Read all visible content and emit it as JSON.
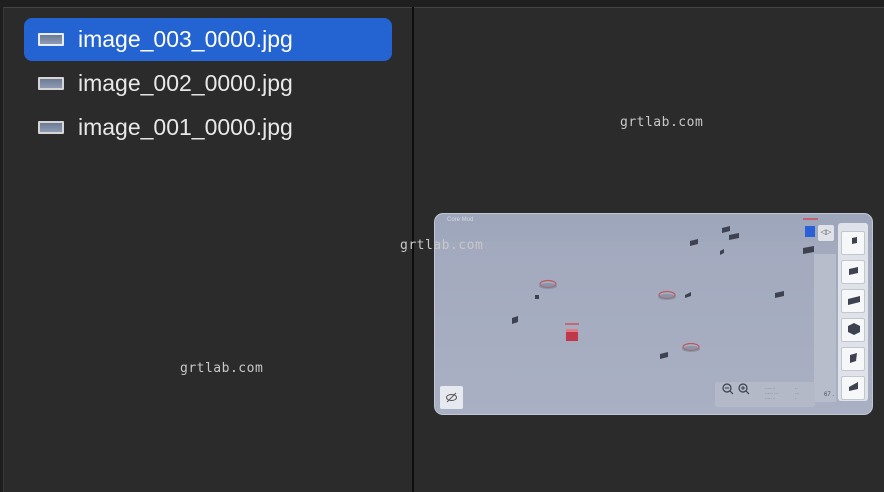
{
  "files": [
    {
      "name": "image_003_0000.jpg",
      "selected": true
    },
    {
      "name": "image_002_0000.jpg",
      "selected": false
    },
    {
      "name": "image_001_0000.jpg",
      "selected": false
    }
  ],
  "watermarks": [
    "grtlab.com",
    "grtlab.com",
    "grtlab.com"
  ],
  "preview": {
    "title": "Core Mod",
    "corner_text": "67 ."
  },
  "colors": {
    "selection": "#2463d2",
    "background": "#2b2b2b"
  }
}
